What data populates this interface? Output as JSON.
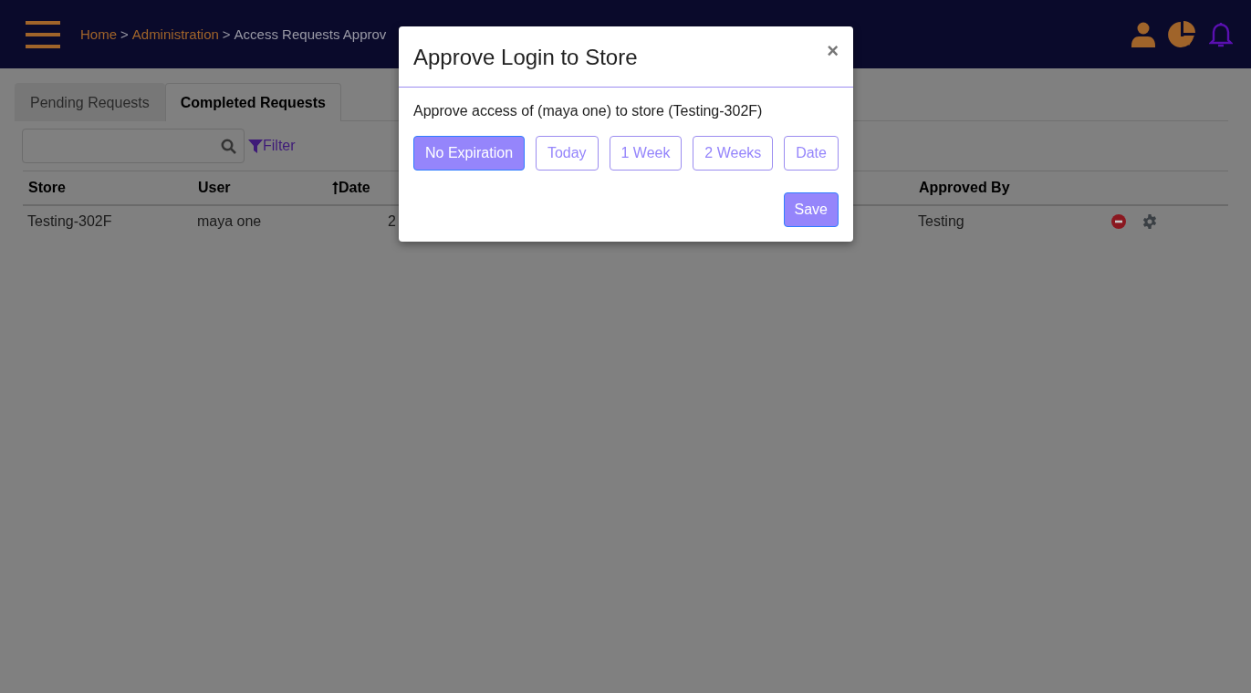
{
  "header": {
    "breadcrumbs": [
      {
        "label": "Home",
        "link": true
      },
      {
        "separator": ">"
      },
      {
        "label": "Administration",
        "link": true
      },
      {
        "separator": ">"
      },
      {
        "label": "Access Requests Approv",
        "link": false
      }
    ]
  },
  "tabs": [
    {
      "label": "Pending Requests",
      "selected": false
    },
    {
      "label": "Completed Requests",
      "selected": true
    }
  ],
  "filter": {
    "label": "Filter"
  },
  "table": {
    "columns": [
      {
        "label": "Store",
        "sorted": false
      },
      {
        "label": "User",
        "sorted": false
      },
      {
        "label": "Date",
        "sorted": true
      },
      {
        "label": "Approved By",
        "sorted": false
      }
    ],
    "rows": [
      {
        "store": "Testing-302F",
        "user": "maya one",
        "date": "2",
        "approved_by": "Testing"
      }
    ]
  },
  "dialog": {
    "title": "Approve Login to Store",
    "close": "×",
    "message": "Approve access of (maya one) to store (Testing-302F)",
    "options": [
      {
        "label": "No Expiration",
        "selected": true
      },
      {
        "label": "Today",
        "selected": false
      },
      {
        "label": "1 Week",
        "selected": false
      },
      {
        "label": "2 Weeks",
        "selected": false
      },
      {
        "label": "Date",
        "selected": false
      }
    ],
    "save": "Save"
  }
}
